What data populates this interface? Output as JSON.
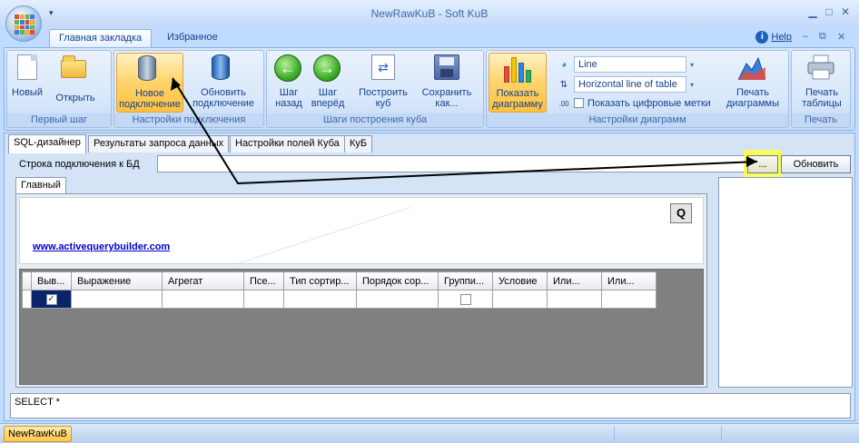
{
  "window": {
    "title": "NewRawKuB - Soft KuB",
    "controls": {
      "minimize": "▁",
      "maximize": "□",
      "close": "✕"
    },
    "qat_dropdown": "▾"
  },
  "ribbon_tabs": {
    "main": "Главная закладка",
    "favorites": "Избранное",
    "help": "Help",
    "help_icon": "i",
    "mdi_minimize": "–",
    "mdi_restore": "⧉",
    "mdi_close": "✕"
  },
  "groups": {
    "first_step": {
      "label": "Первый шаг",
      "new": "Новый",
      "open": "Открыть"
    },
    "connection": {
      "label": "Настройки подключения",
      "new_conn_1": "Новое",
      "new_conn_2": "подключение",
      "refresh_conn_1": "Обновить",
      "refresh_conn_2": "подключение"
    },
    "cube_steps": {
      "label": "Шаги построения куба",
      "back_1": "Шаг",
      "back_2": "назад",
      "forward_1": "Шаг",
      "forward_2": "вперёд",
      "build_1": "Построить",
      "build_2": "куб",
      "save_1": "Сохранить",
      "save_2": "как..."
    },
    "chart_settings": {
      "label": "Настройки диаграмм",
      "show_1": "Показать",
      "show_2": "диаграмму",
      "chart_type": "Line",
      "line_type": "Horizontal line of table",
      "digit_labels": "Показать цифровые метки",
      "digit_icon": ".00",
      "print_1": "Печать",
      "print_2": "диаграммы"
    },
    "print": {
      "label": "Печать",
      "print_1": "Печать",
      "print_2": "таблицы"
    }
  },
  "doc_tabs": [
    "SQL-дизайнер",
    "Результаты запроса данных",
    "Настройки полей Куба",
    "КуБ"
  ],
  "connection": {
    "label": "Строка подключения к БД",
    "value": "",
    "browse_button": "...",
    "refresh_button": "Обновить"
  },
  "designer": {
    "tab": "Главный",
    "q_button": "Q",
    "link": "www.activequerybuilder.com",
    "columns": [
      "Выв...",
      "Выражение",
      "Агрегат",
      "Псе...",
      "Тип сортир...",
      "Порядок сор...",
      "Группи...",
      "Условие",
      "Или...",
      "Или..."
    ],
    "row_check_visible": "✓",
    "row_check_group": ""
  },
  "sql": {
    "text": "SELECT *"
  },
  "statusbar": {
    "task": "NewRawKuB"
  },
  "colors": {
    "highlight": "#ffff44",
    "arrow": "#000000",
    "ribbon_bg": "#bfdbff",
    "active_button": "#ffd36a"
  }
}
